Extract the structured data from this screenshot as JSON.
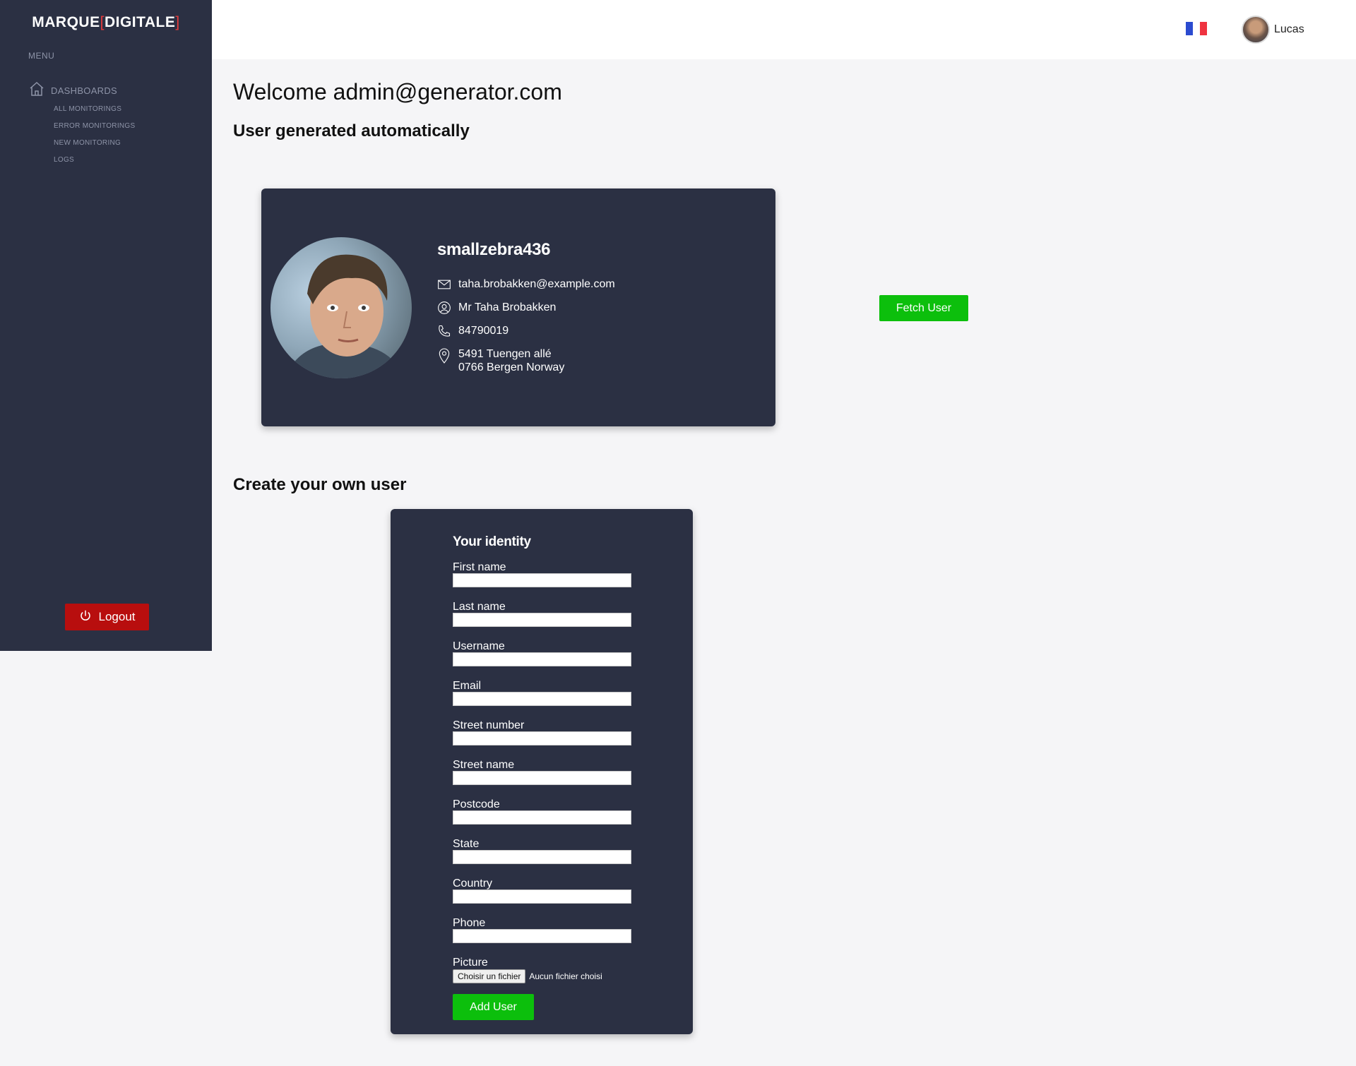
{
  "sidebar": {
    "brand_name": "MARQUE",
    "brand_accent": "DIGITALE",
    "menu_label": "MENU",
    "group_label": "DASHBOARDS",
    "items": [
      {
        "label": "ALL MONITORINGS"
      },
      {
        "label": "ERROR MONITORINGS"
      },
      {
        "label": "NEW MONITORING"
      },
      {
        "label": "LOGS"
      }
    ],
    "logout_label": "Logout"
  },
  "topbar": {
    "language_flag": "fr-flag",
    "user_name": "Lucas"
  },
  "main": {
    "welcome": "Welcome admin@generator.com",
    "auto_heading": "User generated automatically",
    "create_heading": "Create your own user"
  },
  "user_card": {
    "username": "smallzebra436",
    "email": "taha.brobakken@example.com",
    "full_name": "Mr Taha Brobakken",
    "phone": "84790019",
    "address_line1": "5491 Tuengen allé",
    "address_line2": "0766 Bergen Norway"
  },
  "fetch_label": "Fetch User",
  "form": {
    "title": "Your identity",
    "fields": [
      {
        "label": "First name",
        "value": ""
      },
      {
        "label": "Last name",
        "value": ""
      },
      {
        "label": "Username",
        "value": ""
      },
      {
        "label": "Email",
        "value": ""
      },
      {
        "label": "Street number",
        "value": ""
      },
      {
        "label": "Street name",
        "value": ""
      },
      {
        "label": "Postcode",
        "value": ""
      },
      {
        "label": "State",
        "value": ""
      },
      {
        "label": "Country",
        "value": ""
      },
      {
        "label": "Phone",
        "value": ""
      }
    ],
    "picture_label": "Picture",
    "file_button": "Choisir un fichier",
    "file_status": "Aucun fichier choisi",
    "submit_label": "Add User"
  },
  "colors": {
    "sidebar_bg": "#2b3043",
    "accent_green": "#0cbf0c",
    "logout_red": "#b80e0e",
    "brand_bracket": "#e63b3b"
  }
}
